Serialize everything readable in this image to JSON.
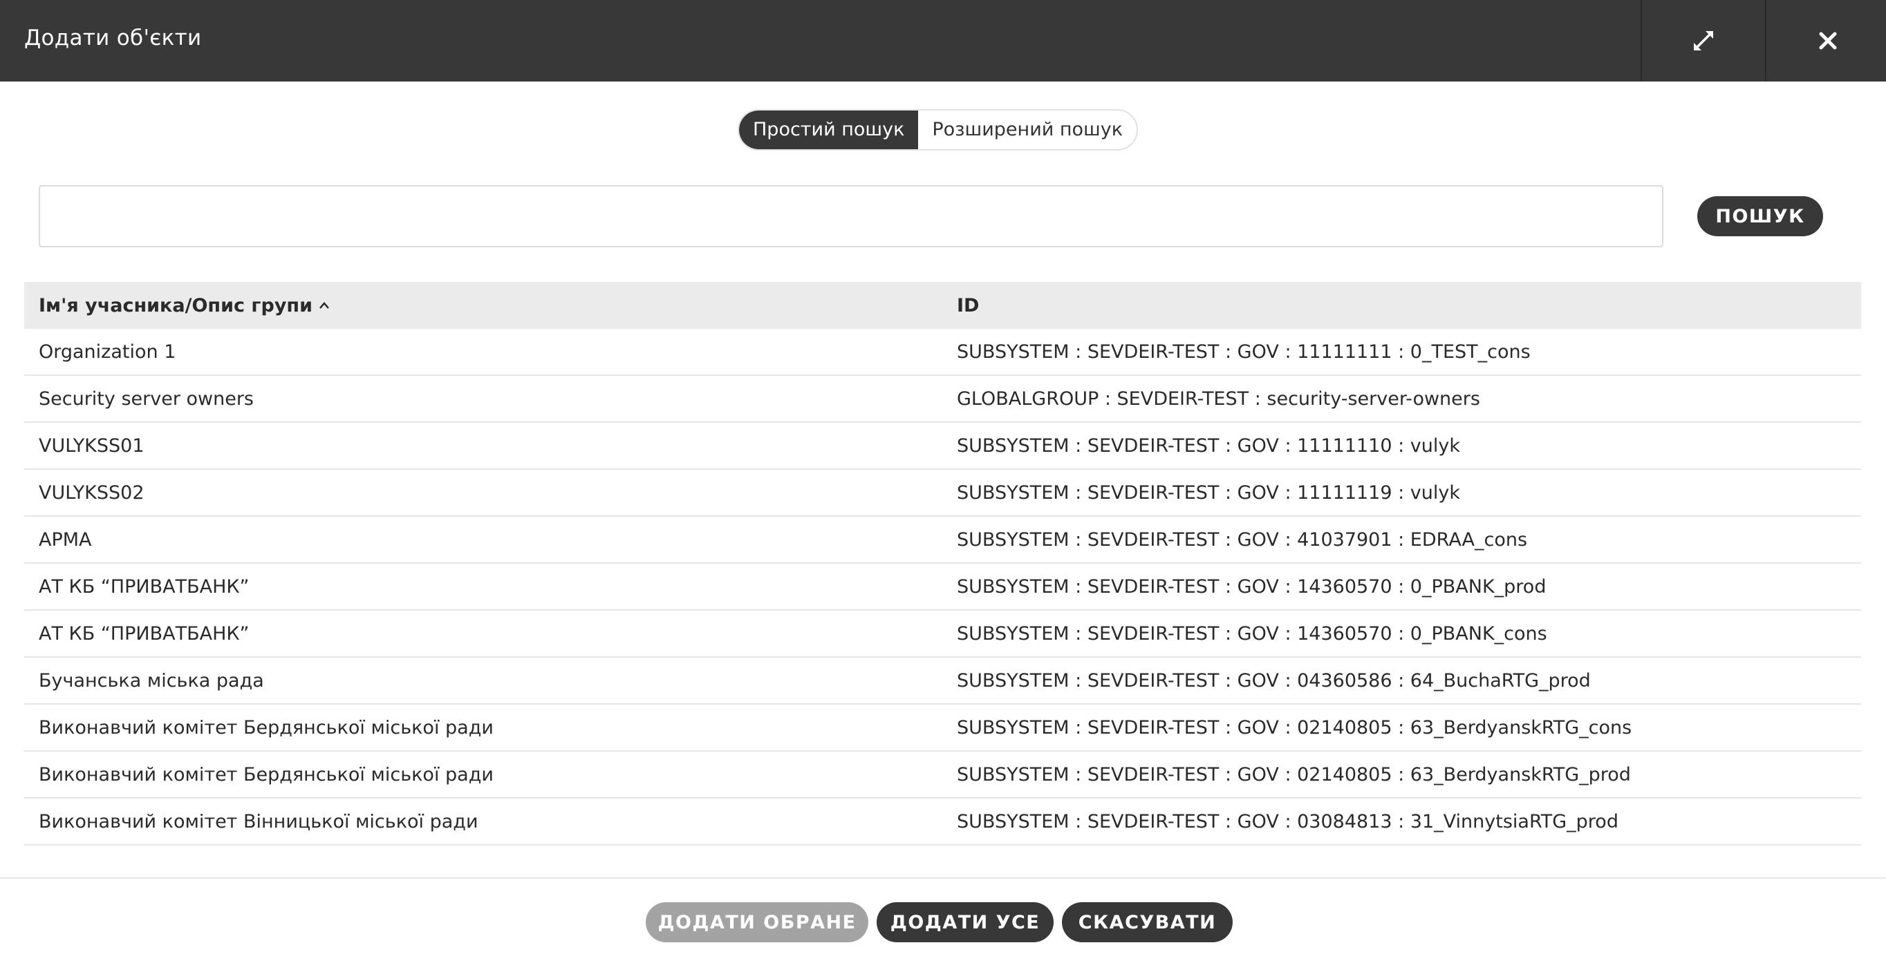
{
  "dialog": {
    "title": "Додати об'єкти"
  },
  "search_mode": {
    "simple_label": "Простий пошук",
    "advanced_label": "Розширений пошук",
    "active": "simple"
  },
  "search": {
    "value": "",
    "placeholder": "",
    "button_label": "ПОШУК"
  },
  "table": {
    "columns": {
      "name": "Ім'я учасника/Опис групи",
      "id": "ID"
    },
    "sort": {
      "column": "name",
      "direction": "ascending"
    },
    "rows": [
      {
        "name": "Organization 1",
        "id": "SUBSYSTEM : SEVDEIR-TEST : GOV : 11111111 : 0_TEST_cons"
      },
      {
        "name": "Security server owners",
        "id": "GLOBALGROUP : SEVDEIR-TEST : security-server-owners"
      },
      {
        "name": "VULYKSS01",
        "id": "SUBSYSTEM : SEVDEIR-TEST : GOV : 11111110 : vulyk"
      },
      {
        "name": "VULYKSS02",
        "id": "SUBSYSTEM : SEVDEIR-TEST : GOV : 11111119 : vulyk"
      },
      {
        "name": "АРМА",
        "id": "SUBSYSTEM : SEVDEIR-TEST : GOV : 41037901 : EDRAA_cons"
      },
      {
        "name": "АТ КБ “ПРИВАТБАНК”",
        "id": "SUBSYSTEM : SEVDEIR-TEST : GOV : 14360570 : 0_PBANK_prod"
      },
      {
        "name": "АТ КБ “ПРИВАТБАНК”",
        "id": "SUBSYSTEM : SEVDEIR-TEST : GOV : 14360570 : 0_PBANK_cons"
      },
      {
        "name": "Бучанська міська рада",
        "id": "SUBSYSTEM : SEVDEIR-TEST : GOV : 04360586 : 64_BuchaRTG_prod"
      },
      {
        "name": "Виконавчий комітет Бердянської міської ради",
        "id": "SUBSYSTEM : SEVDEIR-TEST : GOV : 02140805 : 63_BerdyanskRTG_cons"
      },
      {
        "name": "Виконавчий комітет Бердянської міської ради",
        "id": "SUBSYSTEM : SEVDEIR-TEST : GOV : 02140805 : 63_BerdyanskRTG_prod"
      },
      {
        "name": "Виконавчий комітет Вінницької міської ради",
        "id": "SUBSYSTEM : SEVDEIR-TEST : GOV : 03084813 : 31_VinnytsiaRTG_prod"
      }
    ]
  },
  "footer": {
    "add_selected_label": "ДОДАТИ ОБРАНЕ",
    "add_all_label": "ДОДАТИ УСЕ",
    "cancel_label": "СКАСУВАТИ"
  },
  "icons": {
    "expand": "expand-icon",
    "close": "close-icon",
    "sort": "chevron-up-icon"
  },
  "colors": {
    "header_bg": "#383838",
    "table_header_bg": "#ebebeb",
    "disabled_button": "#a3a3a3",
    "text": "#2a2a2a"
  }
}
